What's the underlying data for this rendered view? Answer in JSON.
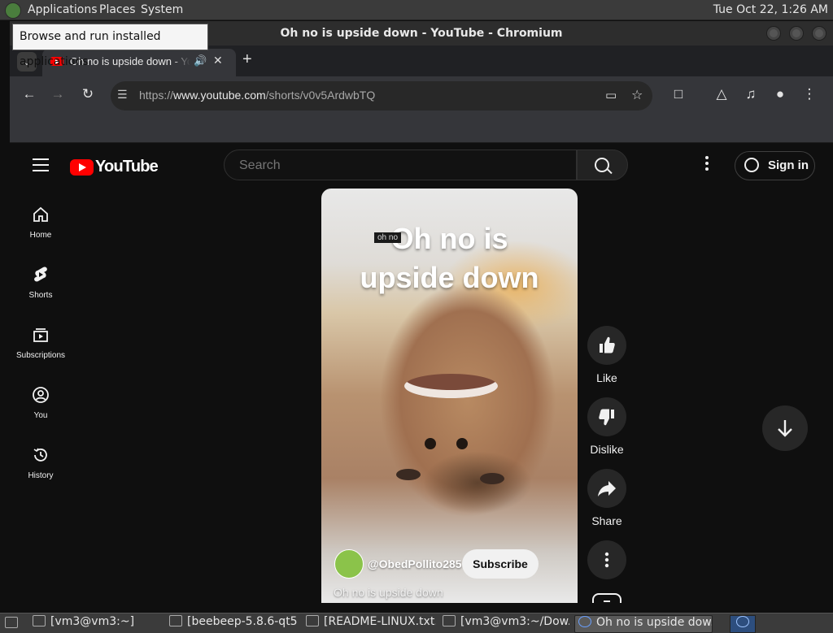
{
  "system_panel": {
    "menus": [
      "Applications",
      "Places",
      "System"
    ],
    "clock": "Tue Oct 22,  1:26 AM"
  },
  "tooltip": "Browse and run installed applications",
  "window": {
    "title": "Oh no is upside down - YouTube - Chromium"
  },
  "tab": {
    "title": "Oh no is upside down - YouTube",
    "new_tab_label": "+"
  },
  "toolbar": {
    "url_scheme": "https://",
    "url_host": "www.youtube.com",
    "url_path": "/shorts/v0v5ArdwbTQ"
  },
  "youtube": {
    "logo_text": "YouTube",
    "search_placeholder": "Search",
    "sign_in_label": "Sign in",
    "sidebar": [
      {
        "label": "Home",
        "icon": "home-icon"
      },
      {
        "label": "Shorts",
        "icon": "shorts-icon"
      },
      {
        "label": "Subscriptions",
        "icon": "subscriptions-icon"
      },
      {
        "label": "You",
        "icon": "you-icon"
      },
      {
        "label": "History",
        "icon": "history-icon"
      }
    ]
  },
  "short": {
    "overlay_title_line1": "Oh no is",
    "overlay_title_line2": "upside down",
    "caption_chip": "oh no",
    "channel_name": "@ObedPollito285",
    "subscribe_label": "Subscribe",
    "video_title": "Oh no is upside down"
  },
  "actions": {
    "like_label": "Like",
    "dislike_label": "Dislike",
    "share_label": "Share"
  },
  "taskbar": {
    "items": [
      {
        "label": "[vm3@vm3:~]"
      },
      {
        "label": "[beebeep-5.8.6-qt5..."
      },
      {
        "label": "[README-LINUX.txt..."
      },
      {
        "label": "[vm3@vm3:~/Dow..."
      },
      {
        "label": "Oh no is upside dow..."
      }
    ]
  },
  "colors": {
    "youtube_red": "#ff0000",
    "page_bg": "#0f0f0f",
    "chrome_toolbar": "#35363a"
  }
}
